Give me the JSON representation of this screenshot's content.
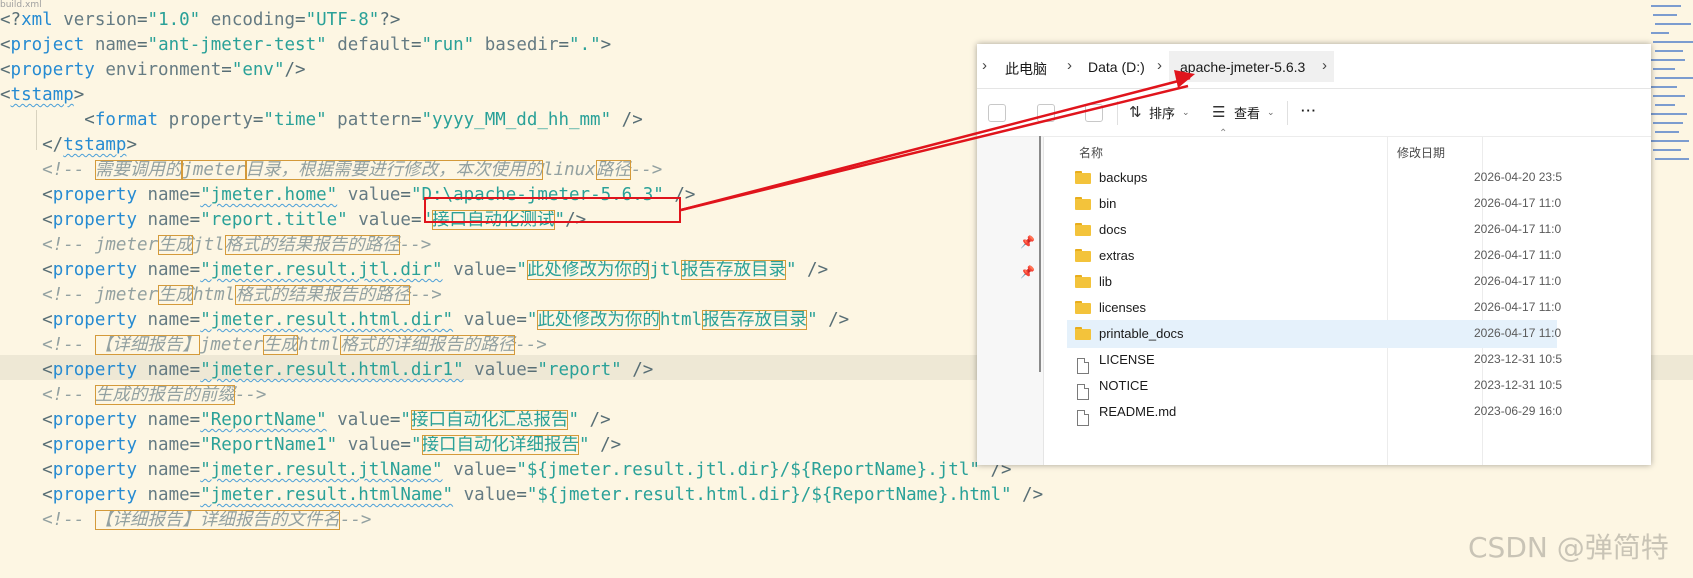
{
  "editor": {
    "tab_fragment": "build.xml",
    "lines": [
      [
        [
          "pun",
          "<?"
        ],
        [
          "tag",
          "xml"
        ],
        [
          "attr",
          " version"
        ],
        [
          "pun",
          "="
        ],
        [
          "str",
          "\"1.0\""
        ],
        [
          "attr",
          " encoding"
        ],
        [
          "pun",
          "="
        ],
        [
          "str",
          "\"UTF-8\""
        ],
        [
          "pun",
          "?>"
        ]
      ],
      [
        [
          "pun",
          "<"
        ],
        [
          "tag",
          "project"
        ],
        [
          "attr",
          " name"
        ],
        [
          "pun",
          "="
        ],
        [
          "str",
          "\"ant-jmeter-test\""
        ],
        [
          "attr",
          " default"
        ],
        [
          "pun",
          "="
        ],
        [
          "str",
          "\"run\""
        ],
        [
          "attr",
          " basedir"
        ],
        [
          "pun",
          "="
        ],
        [
          "str",
          "\".\""
        ],
        [
          "pun",
          ">"
        ]
      ],
      [
        [
          "pun",
          "<"
        ],
        [
          "tag",
          "property"
        ],
        [
          "attr",
          " environment"
        ],
        [
          "pun",
          "="
        ],
        [
          "str",
          "\"env\""
        ],
        [
          "pun",
          "/>"
        ]
      ],
      [
        [
          "pun",
          "<"
        ],
        [
          "tag",
          "tstamp"
        ],
        [
          "pun",
          ">"
        ]
      ],
      [
        [
          "pun",
          "        <"
        ],
        [
          "tag",
          "format"
        ],
        [
          "attr",
          " property"
        ],
        [
          "pun",
          "="
        ],
        [
          "str",
          "\"time\""
        ],
        [
          "attr",
          " pattern"
        ],
        [
          "pun",
          "="
        ],
        [
          "str",
          "\"yyyy_MM_dd_hh_mm\""
        ],
        [
          "pun",
          " />"
        ]
      ],
      [
        [
          "pun",
          "    </"
        ],
        [
          "tag",
          "tstamp"
        ],
        [
          "pun",
          ">"
        ]
      ],
      [
        [
          "cmt",
          "    <!-- "
        ],
        [
          "cmt box",
          "需要调用的"
        ],
        [
          "cmt box",
          "jmeter"
        ],
        [
          "cmt box",
          "目录，根据需要进行修改，本次使用的"
        ],
        [
          "cmt",
          "linux"
        ],
        [
          "cmt box",
          "路径"
        ],
        [
          "cmt",
          "-->"
        ]
      ],
      [
        [
          "pun",
          "    <"
        ],
        [
          "tag",
          "property"
        ],
        [
          "attr",
          " name"
        ],
        [
          "pun",
          "="
        ],
        [
          "str",
          "\"jmeter.home\""
        ],
        [
          "attr",
          " value"
        ],
        [
          "pun",
          "="
        ],
        [
          "str",
          "\"D:\\apache-jmeter-5.6.3\""
        ],
        [
          "pun",
          " />"
        ]
      ],
      [
        [
          "pun",
          "    <"
        ],
        [
          "tag",
          "property"
        ],
        [
          "attr",
          " name"
        ],
        [
          "pun",
          "="
        ],
        [
          "str",
          "\"report.title\""
        ],
        [
          "attr",
          " value"
        ],
        [
          "pun",
          "="
        ],
        [
          "str",
          "\""
        ],
        [
          "str box",
          "接口自动化测试"
        ],
        [
          "str",
          "\""
        ],
        [
          "pun",
          "/>"
        ]
      ],
      [
        [
          "cmt",
          "    <!-- "
        ],
        [
          "cmt",
          "jmeter"
        ],
        [
          "cmt box",
          "生成"
        ],
        [
          "cmt",
          "jtl"
        ],
        [
          "cmt box",
          "格式的结果报告的路径"
        ],
        [
          "cmt",
          "-->"
        ]
      ],
      [
        [
          "pun",
          "    <"
        ],
        [
          "tag",
          "property"
        ],
        [
          "attr",
          " name"
        ],
        [
          "pun",
          "="
        ],
        [
          "str",
          "\"jmeter.result.jtl.dir\""
        ],
        [
          "attr",
          " value"
        ],
        [
          "pun",
          "="
        ],
        [
          "str",
          "\""
        ],
        [
          "str box",
          "此处修改为你的"
        ],
        [
          "str",
          "jtl"
        ],
        [
          "str box",
          "报告存放目录"
        ],
        [
          "str",
          "\""
        ],
        [
          "pun",
          " />"
        ]
      ],
      [
        [
          "cmt",
          "    <!-- "
        ],
        [
          "cmt",
          "jmeter"
        ],
        [
          "cmt box",
          "生成"
        ],
        [
          "cmt",
          "html"
        ],
        [
          "cmt box",
          "格式的结果报告的路径"
        ],
        [
          "cmt",
          "-->"
        ]
      ],
      [
        [
          "pun",
          "    <"
        ],
        [
          "tag",
          "property"
        ],
        [
          "attr",
          " name"
        ],
        [
          "pun",
          "="
        ],
        [
          "str",
          "\"jmeter.result.html.dir\""
        ],
        [
          "attr",
          " value"
        ],
        [
          "pun",
          "="
        ],
        [
          "str",
          "\""
        ],
        [
          "str box",
          "此处修改为你的"
        ],
        [
          "str",
          "html"
        ],
        [
          "str box",
          "报告存放目录"
        ],
        [
          "str",
          "\""
        ],
        [
          "pun",
          " />"
        ]
      ],
      [
        [
          "cmt",
          "    <!-- "
        ],
        [
          "cmt box",
          "【详细报告】"
        ],
        [
          "cmt",
          "jmeter"
        ],
        [
          "cmt box",
          "生成"
        ],
        [
          "cmt",
          "html"
        ],
        [
          "cmt box",
          "格式的详细报告的路径"
        ],
        [
          "cmt",
          "-->"
        ]
      ],
      [
        [
          "pun",
          "    <"
        ],
        [
          "tag",
          "property"
        ],
        [
          "attr",
          " name"
        ],
        [
          "pun",
          "="
        ],
        [
          "str",
          "\"jmeter.result.html.dir1\""
        ],
        [
          "attr",
          " value"
        ],
        [
          "pun",
          "="
        ],
        [
          "str",
          "\"report\""
        ],
        [
          "pun",
          " />"
        ]
      ],
      [
        [
          "cmt",
          "    <!-- "
        ],
        [
          "cmt box",
          "生成的报告的前缀"
        ],
        [
          "cmt",
          "-->"
        ]
      ],
      [
        [
          "pun",
          "    <"
        ],
        [
          "tag",
          "property"
        ],
        [
          "attr",
          " name"
        ],
        [
          "pun",
          "="
        ],
        [
          "str",
          "\"ReportName\""
        ],
        [
          "attr",
          " value"
        ],
        [
          "pun",
          "="
        ],
        [
          "str",
          "\""
        ],
        [
          "str box",
          "接口自动化汇总报告"
        ],
        [
          "str",
          "\""
        ],
        [
          "pun",
          " />"
        ]
      ],
      [
        [
          "pun",
          "    <"
        ],
        [
          "tag",
          "property"
        ],
        [
          "attr",
          " name"
        ],
        [
          "pun",
          "="
        ],
        [
          "str",
          "\"ReportName1\""
        ],
        [
          "attr",
          " value"
        ],
        [
          "pun",
          "="
        ],
        [
          "str",
          "\""
        ],
        [
          "str box",
          "接口自动化详细报告"
        ],
        [
          "str",
          "\""
        ],
        [
          "pun",
          " />"
        ]
      ],
      [
        [
          "pun",
          "    <"
        ],
        [
          "tag",
          "property"
        ],
        [
          "attr",
          " name"
        ],
        [
          "pun",
          "="
        ],
        [
          "str",
          "\"jmeter.result.jtlName\""
        ],
        [
          "attr",
          " value"
        ],
        [
          "pun",
          "="
        ],
        [
          "str",
          "\"${jmeter.result.jtl.dir}/${ReportName}.jtl\""
        ],
        [
          "pun",
          " />"
        ]
      ],
      [
        [
          "pun",
          "    <"
        ],
        [
          "tag",
          "property"
        ],
        [
          "attr",
          " name"
        ],
        [
          "pun",
          "="
        ],
        [
          "str",
          "\"jmeter.result.htmlName\""
        ],
        [
          "attr",
          " value"
        ],
        [
          "pun",
          "="
        ],
        [
          "str",
          "\"${jmeter.result.html.dir}/${ReportName}.html\""
        ],
        [
          "pun",
          " />"
        ]
      ],
      [
        [
          "cmt",
          "    <!-- "
        ],
        [
          "cmt box",
          "【详细报告】详细报告的文件名"
        ],
        [
          "cmt",
          "-->"
        ]
      ]
    ]
  },
  "explorer": {
    "breadcrumb": [
      "此电脑",
      "Data (D:)",
      "apache-jmeter-5.6.3"
    ],
    "toolbar": {
      "sort_label": "排序",
      "view_label": "查看",
      "more_label": "···"
    },
    "columns": {
      "name": "名称",
      "modified": "修改日期"
    },
    "files": [
      {
        "name": "backups",
        "type": "folder",
        "date": "2026-04-20 23:5",
        "selected": false
      },
      {
        "name": "bin",
        "type": "folder",
        "date": "2026-04-17 11:0",
        "selected": false
      },
      {
        "name": "docs",
        "type": "folder",
        "date": "2026-04-17 11:0",
        "selected": false
      },
      {
        "name": "extras",
        "type": "folder",
        "date": "2026-04-17 11:0",
        "selected": false
      },
      {
        "name": "lib",
        "type": "folder",
        "date": "2026-04-17 11:0",
        "selected": false
      },
      {
        "name": "licenses",
        "type": "folder",
        "date": "2026-04-17 11:0",
        "selected": false
      },
      {
        "name": "printable_docs",
        "type": "folder",
        "date": "2026-04-17 11:0",
        "selected": true
      },
      {
        "name": "LICENSE",
        "type": "file",
        "date": "2023-12-31 10:5",
        "selected": false
      },
      {
        "name": "NOTICE",
        "type": "file",
        "date": "2023-12-31 10:5",
        "selected": false
      },
      {
        "name": "README.md",
        "type": "file",
        "date": "2023-06-29 16:0",
        "selected": false
      }
    ]
  },
  "annotation_color": "#e0141c",
  "watermark": "CSDN @弹简特"
}
